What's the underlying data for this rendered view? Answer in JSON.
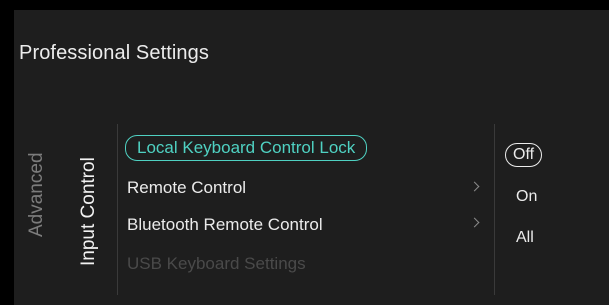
{
  "title": "Professional Settings",
  "tabs": {
    "advanced": "Advanced",
    "input_control": "Input Control"
  },
  "menu": {
    "items": [
      {
        "label": "Local Keyboard Control Lock",
        "state": "selected"
      },
      {
        "label": "Remote Control",
        "state": "normal",
        "submenu": true
      },
      {
        "label": "Bluetooth Remote Control",
        "state": "normal",
        "submenu": true
      },
      {
        "label": "USB Keyboard Settings",
        "state": "disabled"
      }
    ]
  },
  "options": {
    "items": [
      "Off",
      "On",
      "All"
    ],
    "selected": "Off"
  },
  "colors": {
    "accent": "#4fd1c2",
    "panel_bg": "#1e1e1e"
  }
}
